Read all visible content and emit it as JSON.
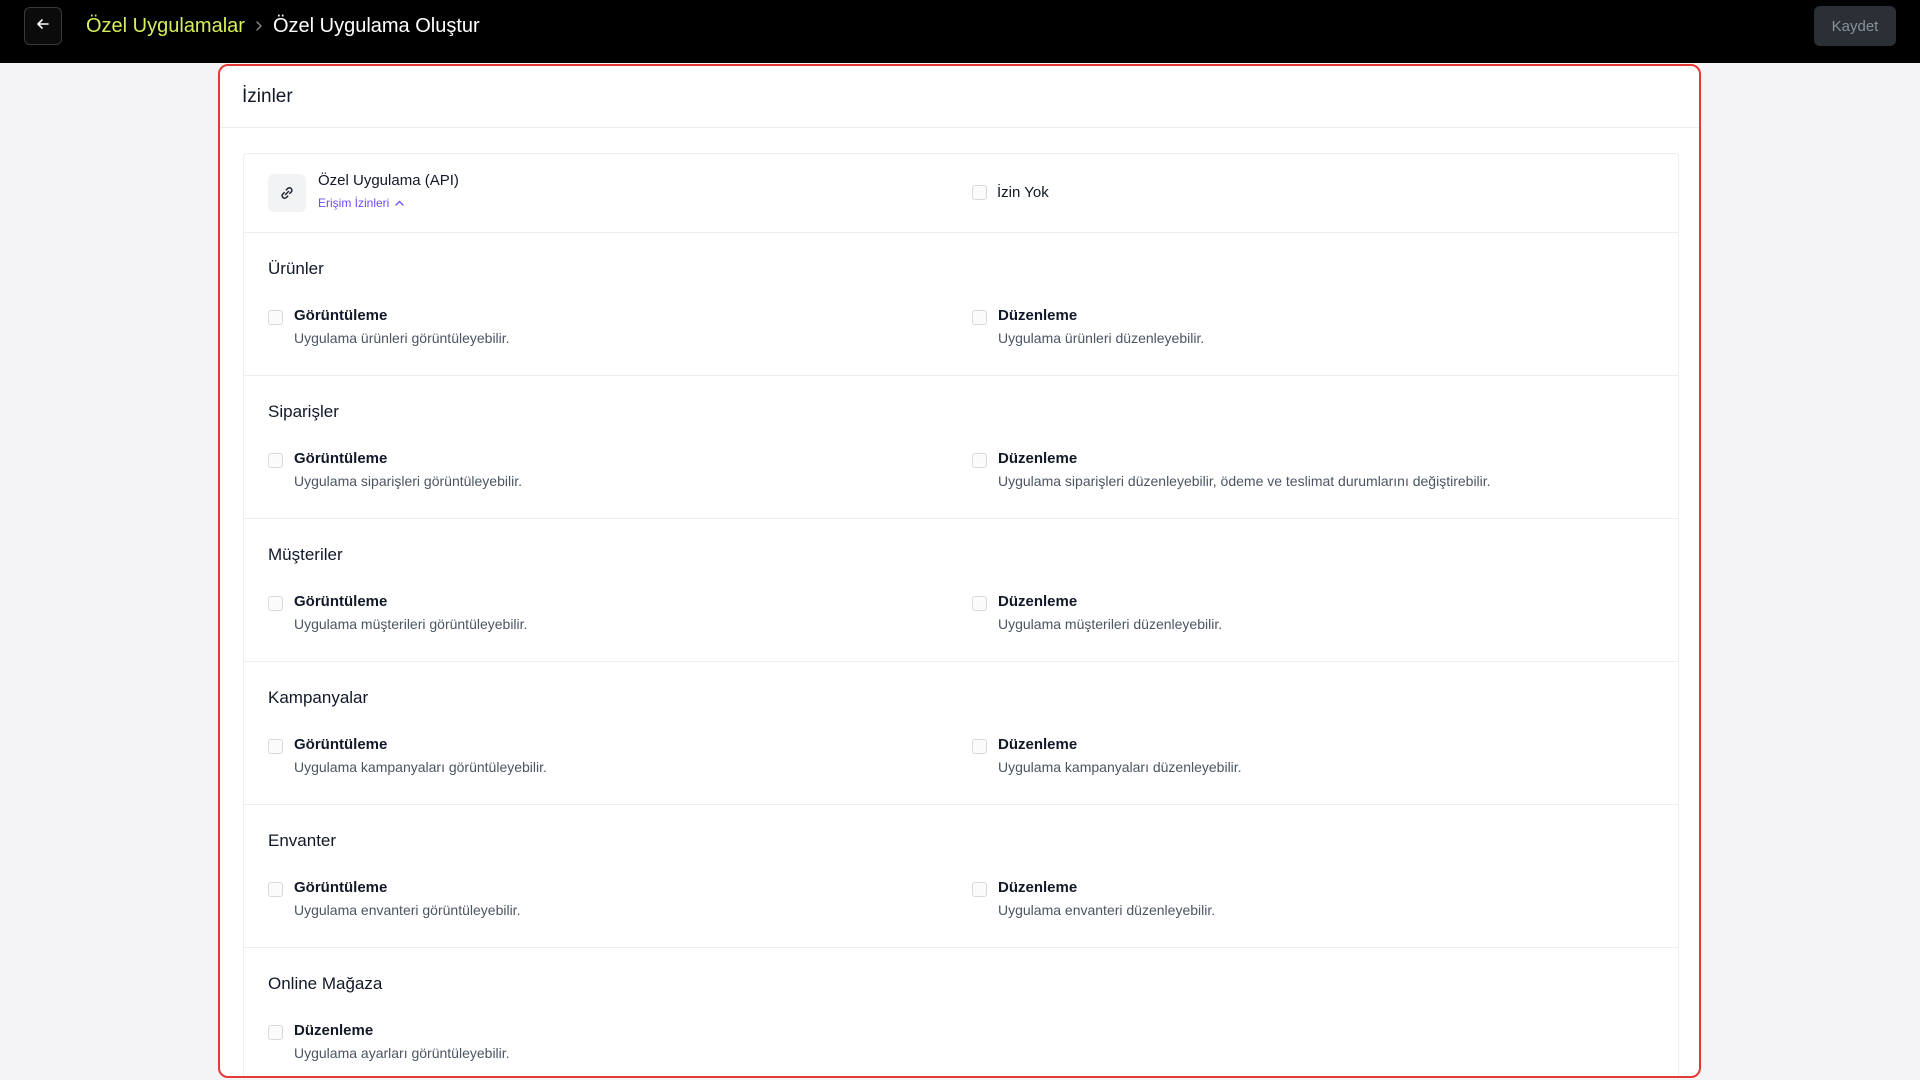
{
  "header": {
    "breadcrumb_parent": "Özel Uygulamalar",
    "breadcrumb_current": "Özel Uygulama Oluştur",
    "save_label": "Kaydet",
    "accent_color": "#d6ef5b"
  },
  "panel": {
    "title": "İzinler",
    "api": {
      "title": "Özel Uygulama (API)",
      "link_label": "Erişim İzinleri",
      "none_label": "İzin Yok"
    },
    "sections": [
      {
        "title": "Ürünler",
        "view_label": "Görüntüleme",
        "view_desc": "Uygulama ürünleri görüntüleyebilir.",
        "edit_label": "Düzenleme",
        "edit_desc": "Uygulama ürünleri düzenleyebilir."
      },
      {
        "title": "Siparişler",
        "view_label": "Görüntüleme",
        "view_desc": "Uygulama siparişleri görüntüleyebilir.",
        "edit_label": "Düzenleme",
        "edit_desc": "Uygulama siparişleri düzenleyebilir, ödeme ve teslimat durumlarını değiştirebilir."
      },
      {
        "title": "Müşteriler",
        "view_label": "Görüntüleme",
        "view_desc": "Uygulama müşterileri görüntüleyebilir.",
        "edit_label": "Düzenleme",
        "edit_desc": "Uygulama müşterileri düzenleyebilir."
      },
      {
        "title": "Kampanyalar",
        "view_label": "Görüntüleme",
        "view_desc": "Uygulama kampanyaları görüntüleyebilir.",
        "edit_label": "Düzenleme",
        "edit_desc": "Uygulama kampanyaları düzenleyebilir."
      },
      {
        "title": "Envanter",
        "view_label": "Görüntüleme",
        "view_desc": "Uygulama envanteri görüntüleyebilir.",
        "edit_label": "Düzenleme",
        "edit_desc": "Uygulama envanteri düzenleyebilir."
      },
      {
        "title": "Online Mağaza",
        "edit_label": "Düzenleme",
        "edit_desc": "Uygulama ayarları görüntüleyebilir."
      }
    ]
  }
}
